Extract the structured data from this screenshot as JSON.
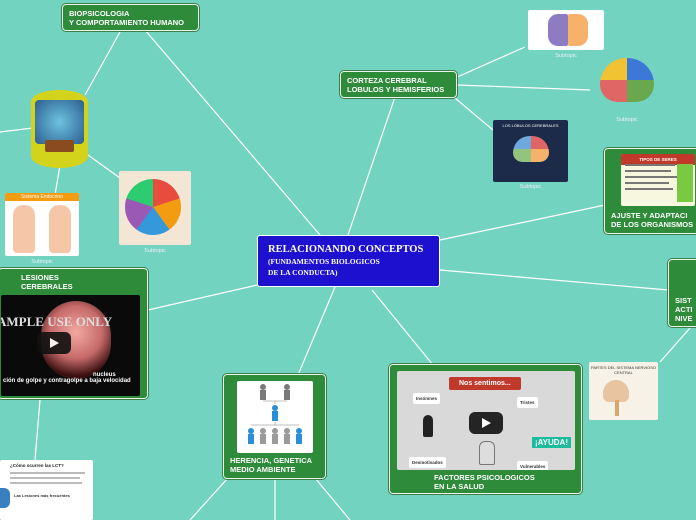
{
  "central": {
    "title": "RELACIONANDO CONCEPTOS",
    "subtitle_1": "(FUNDAMENTOS BIOLOGICOS",
    "subtitle_2": "DE LA CONDUCTA)"
  },
  "nodes": {
    "biopsicologia": [
      "BIOPSICOLOGIA",
      "Y COMPORTAMIENTO HUMANO"
    ],
    "corteza": [
      "CORTEZA CEREBRAL",
      "LOBULOS Y HEMISFERIOS"
    ],
    "ajuste": [
      "AJUSTE Y ADAPTACI",
      "DE LOS ORGANISMOS"
    ],
    "sistema": [
      "SIST",
      "ACTI",
      "NIVE"
    ],
    "lesiones": [
      "LESIONES",
      "CEREBRALES"
    ],
    "herencia": [
      "HERENCIA, GENETICA",
      "MEDIO AMBIENTE"
    ],
    "factores": [
      "FACTORES PSICOLOGICOS",
      "EN LA SALUD"
    ]
  },
  "captions": {
    "subtopic": "Subtopic"
  },
  "thumbs": {
    "endocrine_title": "Sistema Endocrino",
    "lobes_title": "LOS LÓBULOS CEREBRALES",
    "lesion_title": "¿Cómo ocurren las LCT?",
    "lesion_subtitle": "Las Lesiones más frecuentes",
    "ajuste_title": "TIPOS DE SERES",
    "snc_title": "PARTES DEL SISTEMA NERVIOSO CENTRAL"
  },
  "video_lesion": {
    "watermark": "AMPLE USE ONLY",
    "subtitle": "ción de golpe y contragolpe a baja velocidad",
    "label": "nucleus"
  },
  "video_factores": {
    "banner": "Nos sentimos...",
    "labels": [
      "Insómnes",
      "Tristes",
      "Desmotivados",
      "Vulnerables"
    ],
    "help": "¡AYUDA!"
  },
  "colors": {
    "background": "#72d3c0",
    "node": "#2e8b3a",
    "central": "#1d10cf",
    "edge": "#ffffff"
  }
}
